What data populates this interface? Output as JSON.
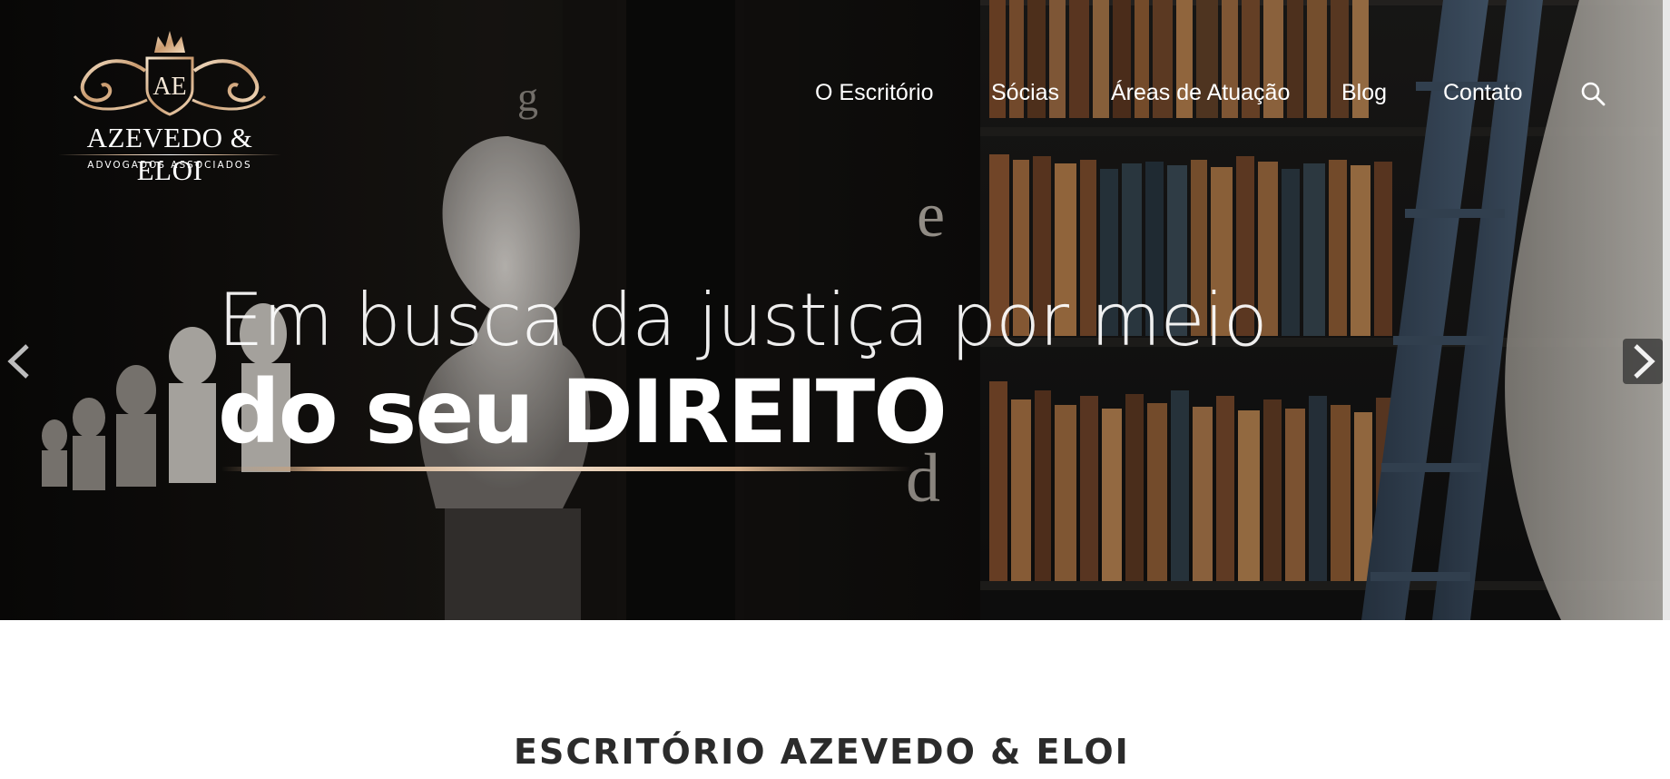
{
  "brand": {
    "monogram": "AE",
    "name": "AZEVEDO & ELOI",
    "tagline": "ADVOGADOS ASSOCIADOS",
    "accent_color": "#d9b99a"
  },
  "nav": {
    "items": [
      "O Escritório",
      "Sócias",
      "Áreas de Atuação",
      "Blog",
      "Contato"
    ],
    "search_icon": "search-icon"
  },
  "hero": {
    "line1": "Em busca da justiça por meio",
    "line2": "do seu DIREITO",
    "prev_icon": "chevron-left-icon",
    "next_icon": "chevron-right-icon",
    "background_letters": [
      "g",
      "e",
      "d"
    ]
  },
  "section": {
    "title": "ESCRITÓRIO AZEVEDO & ELOI"
  }
}
